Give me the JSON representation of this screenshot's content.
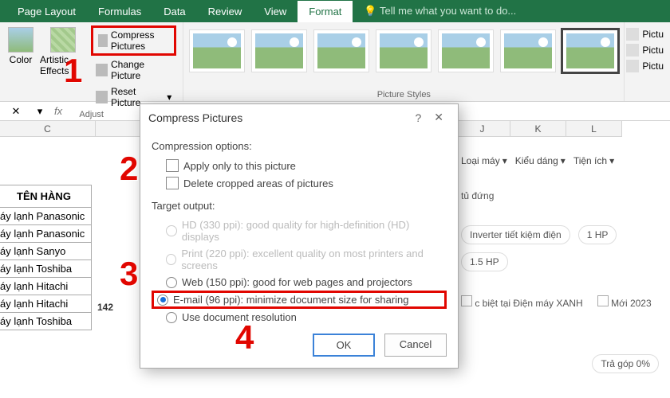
{
  "tabs": {
    "page_layout": "Page Layout",
    "formulas": "Formulas",
    "data": "Data",
    "review": "Review",
    "view": "View",
    "format": "Format",
    "tellme": "Tell me what you want to do..."
  },
  "ribbon": {
    "adjust": {
      "color": "Color",
      "artistic": "Artistic Effects",
      "compress": "Compress Pictures",
      "change": "Change Picture",
      "reset": "Reset Picture",
      "label": "Adjust"
    },
    "styles": {
      "label": "Picture Styles"
    },
    "side": {
      "border": "Pictu",
      "effects": "Pictu",
      "layout": "Pictu"
    }
  },
  "fx": {
    "label": "fx"
  },
  "columns": {
    "c": "C",
    "j": "J",
    "k": "K",
    "l": "L"
  },
  "table": {
    "header": "TÊN HÀNG",
    "rows": [
      "áy lạnh Panasonic",
      "áy lạnh Panasonic",
      "áy lạnh Sanyo",
      "áy lạnh Toshiba",
      "áy lạnh Hitachi",
      "áy lạnh Hitachi",
      "áy lạnh Toshiba"
    ],
    "rownum": "142"
  },
  "rightpanel": {
    "filters": {
      "loai": "Loại máy",
      "kieu": "Kiểu dáng",
      "tien": "Tiện ích"
    },
    "text1": "tủ đứng",
    "tags": {
      "inverter": "Inverter tiết kiệm điện",
      "hp1": "1 HP",
      "hp15": "1.5 HP"
    },
    "check1": "c biệt tại Điện máy XANH",
    "check2": "Mới 2023",
    "bottom": "Trả góp 0%"
  },
  "dialog": {
    "title": "Compress Pictures",
    "sect1": "Compression options:",
    "opt1": "Apply only to this picture",
    "opt2": "Delete cropped areas of pictures",
    "sect2": "Target output:",
    "hd": "HD (330 ppi): good quality for high-definition (HD) displays",
    "print": "Print (220 ppi): excellent quality on most printers and screens",
    "web": "Web (150 ppi): good for web pages and projectors",
    "email": "E-mail (96 ppi): minimize document size for sharing",
    "docres": "Use document resolution",
    "ok": "OK",
    "cancel": "Cancel"
  },
  "callouts": {
    "c1": "1",
    "c2": "2",
    "c3": "3",
    "c4": "4"
  }
}
